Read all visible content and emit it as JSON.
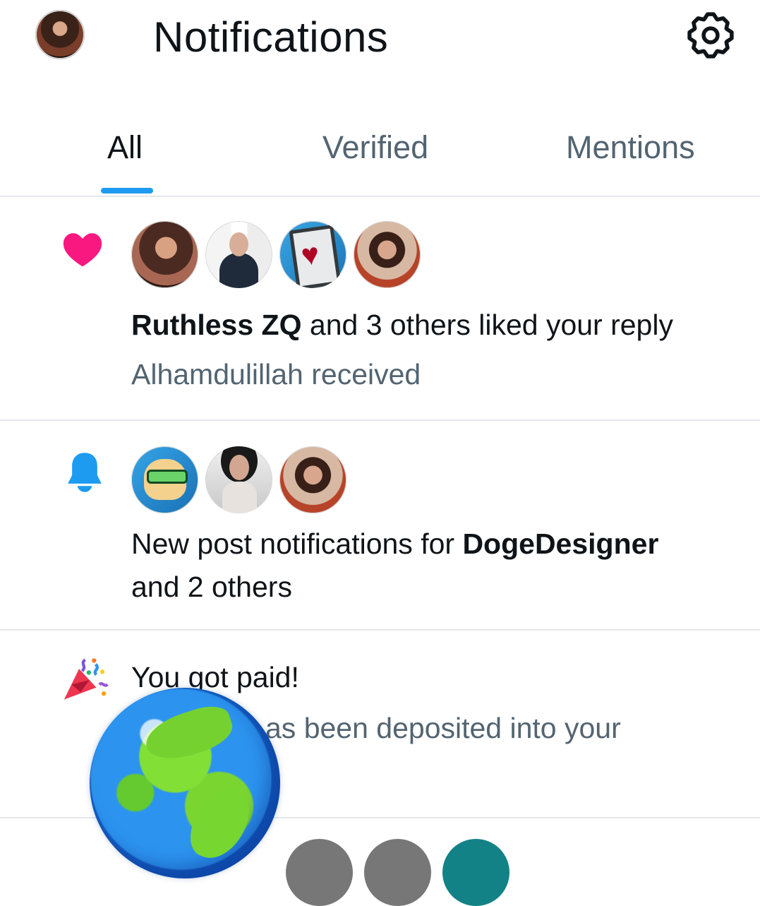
{
  "header": {
    "title": "Notifications"
  },
  "tabs": [
    {
      "label": "All",
      "active": true
    },
    {
      "label": "Verified",
      "active": false
    },
    {
      "label": "Mentions",
      "active": false
    }
  ],
  "notifications": [
    {
      "icon": "heart-icon",
      "actor": "Ruthless ZQ",
      "action": "and 3 others liked your reply",
      "preview": "Alhamdulillah received",
      "color": "#f91880"
    },
    {
      "icon": "bell-icon",
      "prefix": "New post notifications for",
      "actor": "DogeDesigner",
      "suffix": "and 2 others",
      "color": "#1d9bf0"
    },
    {
      "icon": "party-popper-icon",
      "title": "You got paid!",
      "preview_visible": "as been deposited into your"
    }
  ],
  "colors": {
    "accent": "#1d9bf0",
    "muted_text": "#536471",
    "divider": "#e5e7eb"
  }
}
